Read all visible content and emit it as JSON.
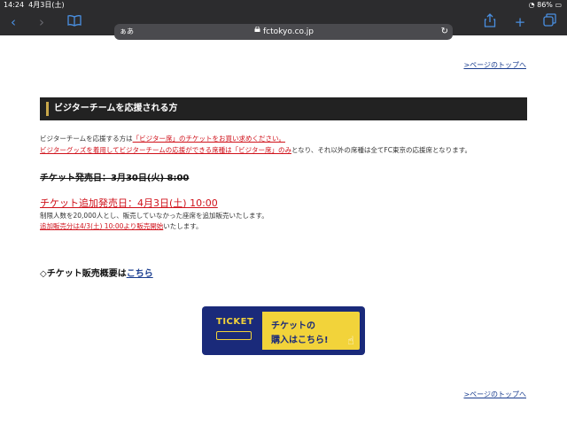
{
  "status": {
    "time": "14:24",
    "date": "4月3日(土)",
    "battery": "86%"
  },
  "browser": {
    "text_size": "ぁあ",
    "host": "fctokyo.co.jp"
  },
  "links": {
    "page_top_1": ">ページのトップへ",
    "page_top_2": ">ページのトップへ"
  },
  "section": {
    "title": "ビジターチームを応援される方"
  },
  "body": {
    "line1_prefix": "ビジターチームを応援する方は",
    "line1_red": "「ビジター席」のチケットをお買い求めください。",
    "line2_red": "ビジターグッズを着用してビジターチームの応援ができる席種は「ビジター席」のみ",
    "line2_rest": "となり、それ以外の席種は全てFC東京の応援席となります。",
    "old_date": "チケット発売日：3月30日(火) 8:00",
    "new_date": "チケット追加発売日：4月3日(土) 10:00",
    "note1": "制限人数を20,000人とし、販売していなかった座席を追加販売いたします。",
    "note2_red": "追加販売分は4/3(土) 10:00より販売開始",
    "note2_rest": "いたします。",
    "overview_prefix": "◇チケット販売概要は",
    "overview_link": "こちら"
  },
  "ticket_button": {
    "badge": "TICKET",
    "line1": "チケットの",
    "line2": "購入はこちら!"
  }
}
